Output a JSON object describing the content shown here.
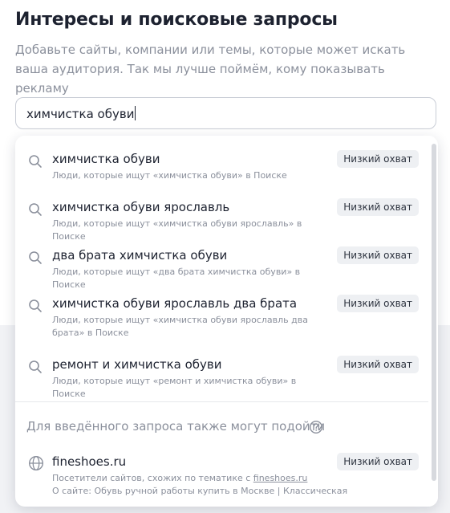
{
  "header": {
    "title": "Интересы и поисковые запросы",
    "description": "Добавьте сайты, компании или темы, которые может искать ваша аудитория. Так мы лучше поймём, кому показывать рекламу"
  },
  "search": {
    "value": "химчистка обуви"
  },
  "suggestions": [
    {
      "title": "химчистка обуви",
      "subtitle": "Люди, которые ищут «химчистка обуви» в Поиске",
      "badge": "Низкий охват"
    },
    {
      "title": "химчистка обуви ярославль",
      "subtitle": "Люди, которые ищут «химчистка обуви ярославль» в Поиске",
      "badge": "Низкий охват"
    },
    {
      "title": "два брата химчистка обуви",
      "subtitle": "Люди, которые ищут «два брата химчистка обуви» в Поиске",
      "badge": "Низкий охват"
    },
    {
      "title": "химчистка обуви ярославль два брата",
      "subtitle": "Люди, которые ищут «химчистка обуви ярославль два брата» в Поиске",
      "badge": "Низкий охват"
    },
    {
      "title": "ремонт и химчистка обуви",
      "subtitle": "Люди, которые ищут «ремонт и химчистка обуви» в Поиске",
      "badge": "Низкий охват"
    }
  ],
  "also_section": {
    "title": "Для введённого запроса также могут подойти",
    "site": {
      "name": "fineshoes.ru",
      "line1_prefix": "Посетители сайтов, схожих по тематике с ",
      "line1_link": "fineshoes.ru",
      "line2": "О сайте: Обувь ручной работы купить в Москве | Классическая",
      "badge": "Низкий охват"
    }
  },
  "icons": {
    "search": "search-icon",
    "help": "question-circle-icon",
    "globe": "globe-icon"
  },
  "colors": {
    "muted_text": "#8b909c",
    "badge_bg": "#eef0f3",
    "border": "#c9cdd6"
  }
}
